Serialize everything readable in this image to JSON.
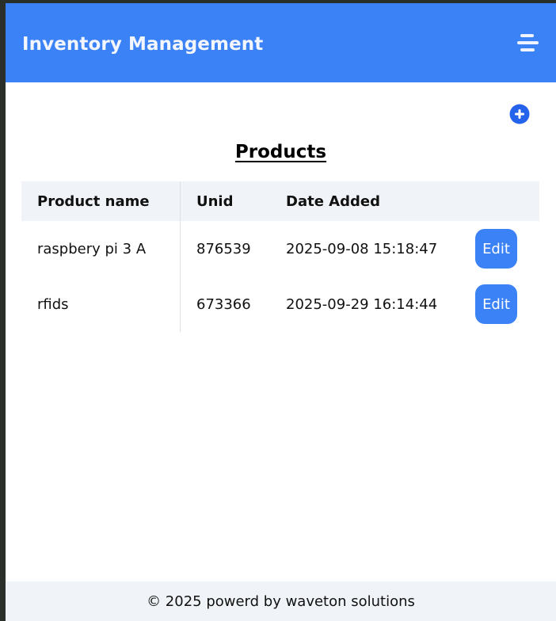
{
  "header": {
    "title": "Inventory Management",
    "menu_icon": "menu-icon",
    "background_color": "#3b82f6"
  },
  "toolbar": {
    "add_icon": "plus-circle-icon",
    "add_color": "#2563eb"
  },
  "main": {
    "section_title": "Products"
  },
  "table": {
    "columns": [
      "Product name",
      "Unid",
      "Date Added"
    ],
    "rows": [
      {
        "name": "raspbery pi 3 A",
        "unid": "876539",
        "date_added": "2025-09-08 15:18:47",
        "action": "Edit"
      },
      {
        "name": "rfids",
        "unid": "673366",
        "date_added": "2025-09-29 16:14:44",
        "action": "Edit"
      }
    ]
  },
  "footer": {
    "text": "© 2025 powerd by waveton solutions"
  }
}
